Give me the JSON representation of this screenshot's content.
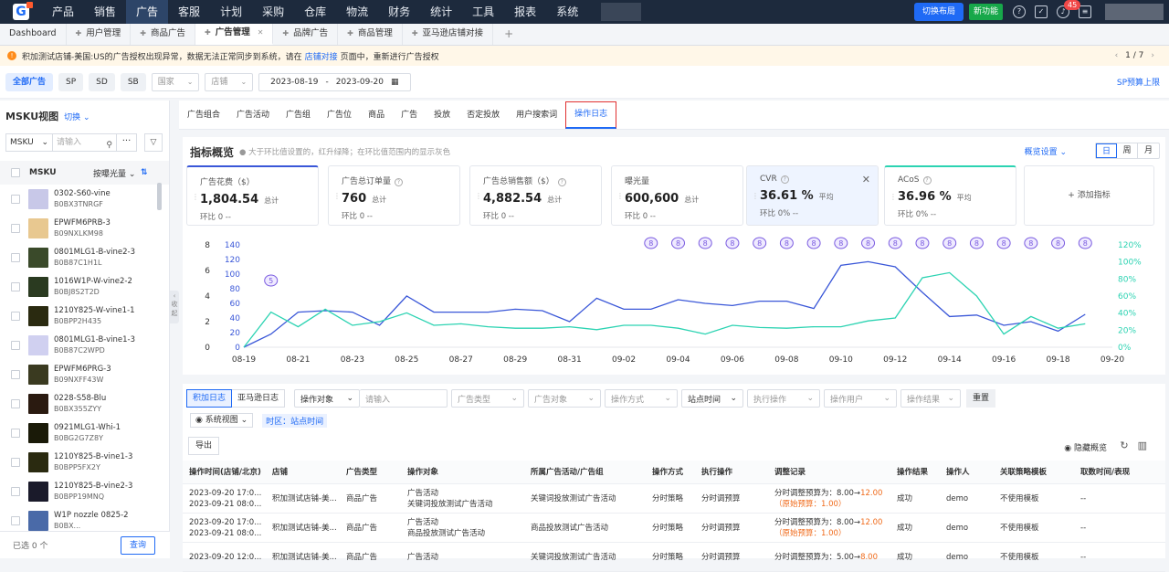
{
  "topnav": {
    "items": [
      "产品",
      "销售",
      "广告",
      "客服",
      "计划",
      "采购",
      "仓库",
      "物流",
      "财务",
      "统计",
      "工具",
      "报表",
      "系统"
    ],
    "active_index": 2,
    "layout_button": "切换布局",
    "new_feature": "新功能",
    "notification_count": "45"
  },
  "tabs": [
    {
      "label": "Dashboard"
    },
    {
      "label": "用户管理"
    },
    {
      "label": "商品广告"
    },
    {
      "label": "广告管理"
    },
    {
      "label": "品牌广告"
    },
    {
      "label": "商品管理"
    },
    {
      "label": "亚马逊店铺对接"
    }
  ],
  "notice": {
    "text_before": "积加测试店铺-美国:US的广告授权出现异常，数据无法正常同步到系统，请在",
    "link": "店铺对接",
    "text_after": "页面中，重新进行广告授权",
    "pager": "1 / 7"
  },
  "filters": {
    "all": "全部广告",
    "sp": "SP",
    "sd": "SD",
    "sb": "SB",
    "country": "国家",
    "shop": "店铺",
    "date_start": "2023-08-19",
    "date_sep": "-",
    "date_end": "2023-09-20",
    "sp_budget": "SP预算上限"
  },
  "sidebar": {
    "title": "MSKU视图",
    "switch": "切换",
    "search_field": "MSKU",
    "search_placeholder": "请输入",
    "col_name": "MSKU",
    "col_sort": "按曝光量",
    "items": [
      {
        "name": "0302-S60-vine",
        "asin": "B0BX3TNRGF"
      },
      {
        "name": "EPWFM6PRB-3",
        "asin": "B09NXLKM98"
      },
      {
        "name": "0801MLG1-B-vine2-3",
        "asin": "B0B87C1H1L"
      },
      {
        "name": "1016W1P-W-vine2-2",
        "asin": "B0BJ8S2T2D"
      },
      {
        "name": "1210Y825-W-vine1-1",
        "asin": "B0BPP2H435"
      },
      {
        "name": "0801MLG1-B-vine1-3",
        "asin": "B0B87C2WPD"
      },
      {
        "name": "EPWFM6PRG-3",
        "asin": "B09NXFF43W"
      },
      {
        "name": "0228-S58-Blu",
        "asin": "B0BX355ZYY"
      },
      {
        "name": "0921MLG1-Whi-1",
        "asin": "B0BG2G7Z8Y"
      },
      {
        "name": "1210Y825-B-vine1-3",
        "asin": "B0BPP5FX2Y"
      },
      {
        "name": "1210Y825-B-vine2-3",
        "asin": "B0BPP19MNQ"
      },
      {
        "name": "W1P nozzle 0825-2",
        "asin": "B0BX..."
      }
    ],
    "selected": "已选 0 个",
    "query": "查询"
  },
  "subtabs": [
    "广告组合",
    "广告活动",
    "广告组",
    "广告位",
    "商品",
    "广告",
    "投放",
    "否定投放",
    "用户搜索词",
    "操作日志"
  ],
  "overview": {
    "title": "指标概览",
    "tip": "大于环比值设置的，红升绿降；在环比值范围内的显示灰色",
    "settings": "概览设置",
    "periods": [
      "日",
      "周",
      "月"
    ],
    "metrics": [
      {
        "name": "广告花费（$）",
        "value": "1,804.54",
        "suffix": "总计",
        "compare": "环比  0  --"
      },
      {
        "name": "广告总订单量",
        "value": "760",
        "suffix": "总计",
        "compare": "环比  0  --"
      },
      {
        "name": "广告总销售额（$）",
        "value": "4,882.54",
        "suffix": "总计",
        "compare": "环比  0  --"
      },
      {
        "name": "曝光量",
        "value": "600,600",
        "suffix": "总计",
        "compare": "环比  0  --"
      },
      {
        "name": "CVR",
        "value": "36.61 %",
        "suffix": "平均",
        "compare": "环比  0%  --"
      },
      {
        "name": "ACoS",
        "value": "36.96 %",
        "suffix": "平均",
        "compare": "环比  0%  --"
      }
    ],
    "add_metric": "+ 添加指标"
  },
  "chart_data": {
    "type": "line",
    "x": [
      "08-19",
      "08-20",
      "08-21",
      "08-22",
      "08-23",
      "08-24",
      "08-25",
      "08-26",
      "08-27",
      "08-28",
      "08-29",
      "08-30",
      "08-31",
      "09-01",
      "09-02",
      "09-03",
      "09-04",
      "09-05",
      "09-06",
      "09-07",
      "09-08",
      "09-09",
      "09-10",
      "09-11",
      "09-12",
      "09-13",
      "09-14",
      "09-15",
      "09-16",
      "09-17",
      "09-18",
      "09-19",
      "09-20"
    ],
    "x_ticks": [
      "08-19",
      "08-21",
      "08-23",
      "08-25",
      "08-27",
      "08-29",
      "08-31",
      "09-02",
      "09-04",
      "09-06",
      "09-08",
      "09-10",
      "09-12",
      "09-14",
      "09-16",
      "09-18",
      "09-20"
    ],
    "y_left_outer": {
      "ticks": [
        "8",
        "6",
        "4",
        "2",
        "0"
      ]
    },
    "y_left_inner": {
      "ticks": [
        "140",
        "120",
        "100",
        "80",
        "60",
        "40",
        "20",
        "0"
      ]
    },
    "y_right": {
      "ticks": [
        "120%",
        "100%",
        "80%",
        "60%",
        "40%",
        "20%",
        "0%"
      ]
    },
    "series": [
      {
        "values": [
          0,
          18,
          48,
          50,
          48,
          30,
          70,
          48,
          48,
          48,
          52,
          50,
          35,
          67,
          52,
          52,
          65,
          60,
          57,
          63,
          63,
          53,
          112,
          117,
          110,
          75,
          42,
          44,
          30,
          35,
          22,
          45
        ]
      },
      {
        "values": [
          0,
          48,
          28,
          52,
          30,
          35,
          47,
          30,
          32,
          28,
          26,
          26,
          28,
          24,
          30,
          30,
          26,
          18,
          30,
          27,
          26,
          28,
          28,
          36,
          40,
          95,
          102,
          70,
          18,
          42,
          26,
          32
        ]
      }
    ],
    "annotations": [
      {
        "x": "08-20",
        "label": "5"
      },
      {
        "x": "09-03",
        "label": "8"
      },
      {
        "x": "09-04",
        "label": "8"
      },
      {
        "x": "09-05",
        "label": "8"
      },
      {
        "x": "09-06",
        "label": "8"
      },
      {
        "x": "09-07",
        "label": "8"
      },
      {
        "x": "09-08",
        "label": "8"
      },
      {
        "x": "09-09",
        "label": "8"
      },
      {
        "x": "09-10",
        "label": "8"
      },
      {
        "x": "09-11",
        "label": "8"
      },
      {
        "x": "09-12",
        "label": "8"
      },
      {
        "x": "09-13",
        "label": "8"
      },
      {
        "x": "09-14",
        "label": "8"
      },
      {
        "x": "09-15",
        "label": "8"
      },
      {
        "x": "09-16",
        "label": "8"
      },
      {
        "x": "09-17",
        "label": "8"
      },
      {
        "x": "09-18",
        "label": "8"
      },
      {
        "x": "09-19",
        "label": "8"
      }
    ],
    "colors": {
      "series1": "#3a57d8",
      "series2": "#2cd3b2",
      "marker": "#7a5be0"
    }
  },
  "ops": {
    "tab_jijia": "积加日志",
    "tab_amazon": "亚马逊日志",
    "op_object": "操作对象",
    "op_input": "请输入",
    "ad_type": "广告类型",
    "ad_object": "广告对象",
    "op_method": "操作方式",
    "site_time": "站点时间",
    "exec_op": "执行操作",
    "op_user": "操作用户",
    "op_result": "操作结果",
    "reset": "重置",
    "sys_view": "系统视图",
    "zone": "时区：站点时间",
    "export": "导出",
    "hide_overview": "隐藏概览",
    "headers": [
      "操作时间(店铺/北京)",
      "店铺",
      "广告类型",
      "操作对象",
      "所属广告活动/广告组",
      "操作方式",
      "执行操作",
      "调整记录",
      "操作结果",
      "操作人",
      "关联策略模板",
      "取数时间/表现"
    ],
    "rows": [
      {
        "time1": "2023-09-20 17:0...",
        "time2": "2023-09-21 08:0...",
        "shop": "积加测试店铺-美...",
        "type": "商品广告",
        "obj1": "广告活动",
        "obj2": "关键词投放测试广告活动",
        "group": "关键词投放测试广告活动",
        "method": "分时策略",
        "exec": "分时调预算",
        "rec1a": "分时调整预算为：8.00→",
        "rec1b": "12.00",
        "rec2": "（原始预算：1.00）",
        "result": "成功",
        "user": "demo",
        "tpl": "不使用模板",
        "fetch": "--"
      },
      {
        "time1": "2023-09-20 17:0...",
        "time2": "2023-09-21 08:0...",
        "shop": "积加测试店铺-美...",
        "type": "商品广告",
        "obj1": "广告活动",
        "obj2": "商品投放测试广告活动",
        "group": "商品投放测试广告活动",
        "method": "分时策略",
        "exec": "分时调预算",
        "rec1a": "分时调整预算为：8.00→",
        "rec1b": "12.00",
        "rec2": "（原始预算：1.00）",
        "result": "成功",
        "user": "demo",
        "tpl": "不使用模板",
        "fetch": "--"
      },
      {
        "time1": "2023-09-20 12:0...",
        "time2": "",
        "shop": "积加测试店铺-美...",
        "type": "商品广告",
        "obj1": "广告活动",
        "obj2": "",
        "group": "关键词投放测试广告活动",
        "method": "分时策略",
        "exec": "分时调预算",
        "rec1a": "分时调整预算为：5.00→",
        "rec1b": "8.00",
        "rec2": "",
        "result": "成功",
        "user": "demo",
        "tpl": "不使用模板",
        "fetch": "--"
      }
    ]
  }
}
